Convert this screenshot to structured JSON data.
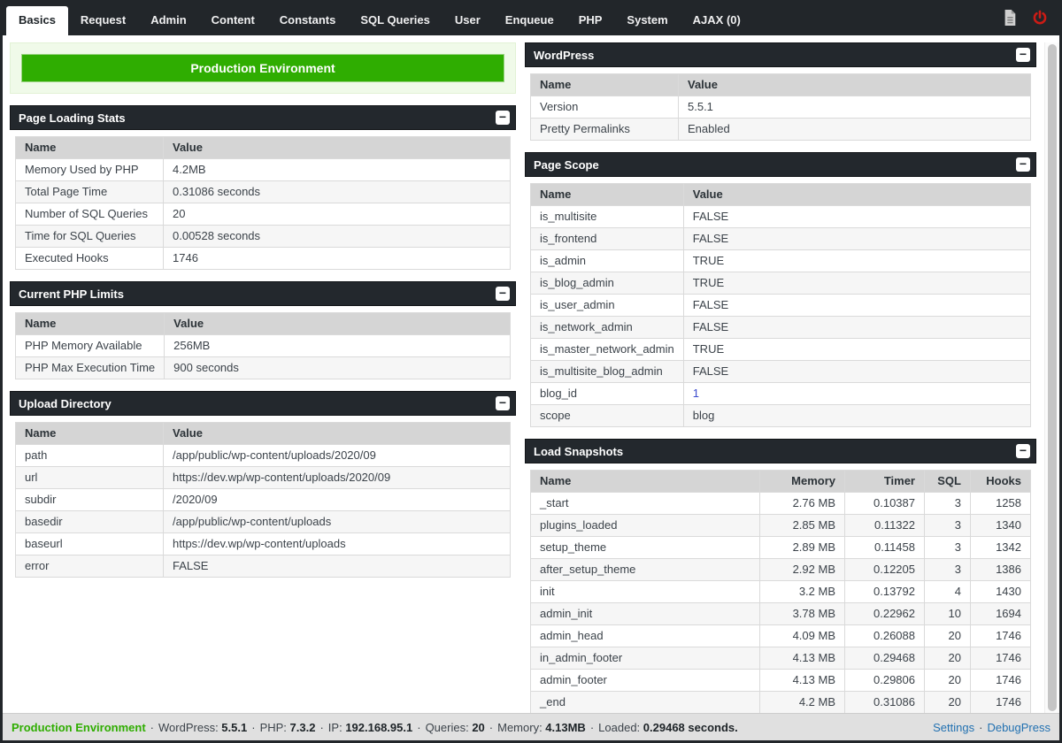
{
  "colors": {
    "accent_green": "#2fad01",
    "header_dark": "#23282d",
    "link_blue": "#2271b1",
    "power_red": "#cc1b15",
    "value_blue": "#3b4bce",
    "table_header_gray": "#d5d5d5"
  },
  "tabs": {
    "items": [
      {
        "label": "Basics",
        "active": true
      },
      {
        "label": "Request",
        "active": false
      },
      {
        "label": "Admin",
        "active": false
      },
      {
        "label": "Content",
        "active": false
      },
      {
        "label": "Constants",
        "active": false
      },
      {
        "label": "SQL Queries",
        "active": false
      },
      {
        "label": "User",
        "active": false
      },
      {
        "label": "Enqueue",
        "active": false
      },
      {
        "label": "PHP",
        "active": false
      },
      {
        "label": "System",
        "active": false
      },
      {
        "label": "AJAX (0)",
        "active": false
      }
    ],
    "icons": [
      "report-icon",
      "power-icon"
    ]
  },
  "banner": {
    "text": "Production Environment"
  },
  "icons": {
    "collapse_glyph": "−"
  },
  "left_panels": [
    {
      "title": "Page Loading Stats",
      "columns": [
        "Name",
        "Value"
      ],
      "rows": [
        [
          "Memory Used by PHP",
          "4.2MB"
        ],
        [
          "Total Page Time",
          "0.31086 seconds"
        ],
        [
          "Number of SQL Queries",
          "20"
        ],
        [
          "Time for SQL Queries",
          "0.00528 seconds"
        ],
        [
          "Executed Hooks",
          "1746"
        ]
      ]
    },
    {
      "title": "Current PHP Limits",
      "columns": [
        "Name",
        "Value"
      ],
      "rows": [
        [
          "PHP Memory Available",
          "256MB"
        ],
        [
          "PHP Max Execution Time",
          "900 seconds"
        ]
      ]
    },
    {
      "title": "Upload Directory",
      "columns": [
        "Name",
        "Value"
      ],
      "rows": [
        [
          "path",
          "/app/public/wp-content/uploads/2020/09"
        ],
        [
          "url",
          "https://dev.wp/wp-content/uploads/2020/09"
        ],
        [
          "subdir",
          "/2020/09"
        ],
        [
          "basedir",
          "/app/public/wp-content/uploads"
        ],
        [
          "baseurl",
          "https://dev.wp/wp-content/uploads"
        ],
        [
          "error",
          "FALSE"
        ]
      ]
    }
  ],
  "right_panels": [
    {
      "title": "WordPress",
      "columns": [
        "Name",
        "Value"
      ],
      "rows": [
        [
          "Version",
          "5.5.1"
        ],
        [
          "Pretty Permalinks",
          "Enabled"
        ]
      ]
    },
    {
      "title": "Page Scope",
      "columns": [
        "Name",
        "Value"
      ],
      "rows": [
        [
          "is_multisite",
          "FALSE"
        ],
        [
          "is_frontend",
          "FALSE"
        ],
        [
          "is_admin",
          "TRUE"
        ],
        [
          "is_blog_admin",
          "TRUE"
        ],
        [
          "is_user_admin",
          "FALSE"
        ],
        [
          "is_network_admin",
          "FALSE"
        ],
        [
          "is_master_network_admin",
          "TRUE"
        ],
        [
          "is_multisite_blog_admin",
          "FALSE"
        ],
        [
          "blog_id",
          {
            "text": "1",
            "style": "number"
          }
        ],
        [
          "scope",
          "blog"
        ]
      ]
    },
    {
      "title": "Load Snapshots",
      "columns": [
        "Name",
        "Memory",
        "Timer",
        "SQL",
        "Hooks"
      ],
      "rows": [
        [
          "_start",
          "2.76 MB",
          "0.10387",
          "3",
          "1258"
        ],
        [
          "plugins_loaded",
          "2.85 MB",
          "0.11322",
          "3",
          "1340"
        ],
        [
          "setup_theme",
          "2.89 MB",
          "0.11458",
          "3",
          "1342"
        ],
        [
          "after_setup_theme",
          "2.92 MB",
          "0.12205",
          "3",
          "1386"
        ],
        [
          "init",
          "3.2 MB",
          "0.13792",
          "4",
          "1430"
        ],
        [
          "admin_init",
          "3.78 MB",
          "0.22962",
          "10",
          "1694"
        ],
        [
          "admin_head",
          "4.09 MB",
          "0.26088",
          "20",
          "1746"
        ],
        [
          "in_admin_footer",
          "4.13 MB",
          "0.29468",
          "20",
          "1746"
        ],
        [
          "admin_footer",
          "4.13 MB",
          "0.29806",
          "20",
          "1746"
        ],
        [
          "_end",
          "4.2 MB",
          "0.31086",
          "20",
          "1746"
        ]
      ]
    }
  ],
  "statusbar": {
    "env": "Production Environment",
    "separator": "·",
    "items": [
      {
        "label": "WordPress:",
        "value": "5.5.1"
      },
      {
        "label": "PHP:",
        "value": "7.3.2"
      },
      {
        "label": "IP:",
        "value": "192.168.95.1"
      },
      {
        "label": "Queries:",
        "value": "20"
      },
      {
        "label": "Memory:",
        "value": "4.13MB"
      },
      {
        "label": "Loaded:",
        "value": "0.29468 seconds."
      }
    ],
    "links": [
      "Settings",
      "DebugPress"
    ]
  }
}
